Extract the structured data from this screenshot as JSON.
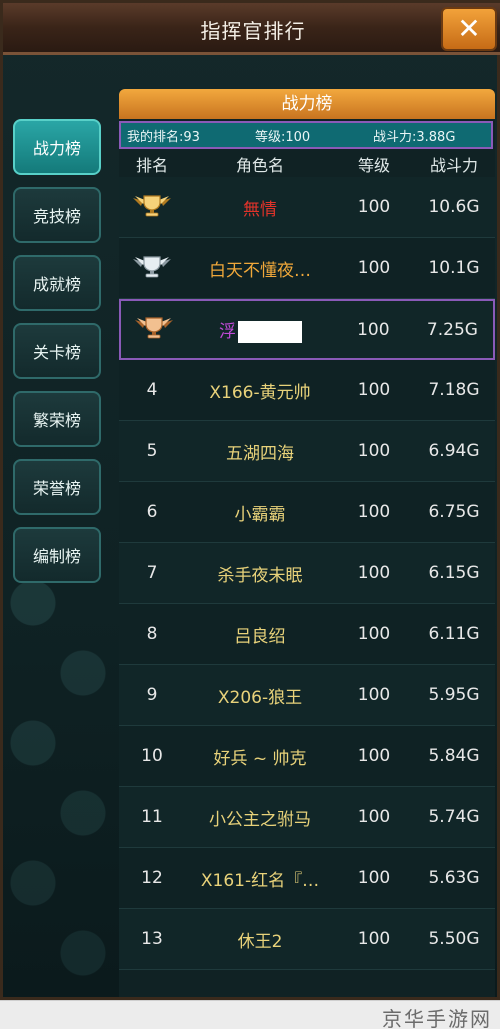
{
  "header": {
    "title": "指挥官排行",
    "close_icon": "close-icon"
  },
  "sidebar": {
    "items": [
      {
        "label": "战力榜",
        "active": true
      },
      {
        "label": "竞技榜",
        "active": false
      },
      {
        "label": "成就榜",
        "active": false
      },
      {
        "label": "关卡榜",
        "active": false
      },
      {
        "label": "繁荣榜",
        "active": false
      },
      {
        "label": "荣誉榜",
        "active": false
      },
      {
        "label": "编制榜",
        "active": false
      }
    ]
  },
  "panel": {
    "title": "战力榜",
    "my_rank": {
      "rank": "我的排名:93",
      "level": "等级:100",
      "power": "战斗力:3.88G"
    },
    "columns": [
      "排名",
      "角色名",
      "等级",
      "战斗力"
    ],
    "rows": [
      {
        "rank": "",
        "medal": "gold-trophy",
        "name": "無情",
        "name_color": "#e0332a",
        "level": "100",
        "power": "10.6G"
      },
      {
        "rank": "",
        "medal": "silver-trophy",
        "name": "白天不懂夜…",
        "name_color": "#f0a83a",
        "level": "100",
        "power": "10.1G"
      },
      {
        "rank": "",
        "medal": "bronze-trophy",
        "name": "浮",
        "name_color": "#c04ad8",
        "level": "100",
        "power": "7.25G",
        "mine": true
      },
      {
        "rank": "4",
        "name": "X166-黄元帅",
        "level": "100",
        "power": "7.18G"
      },
      {
        "rank": "5",
        "name": "五湖四海",
        "level": "100",
        "power": "6.94G"
      },
      {
        "rank": "6",
        "name": "小霸霸",
        "level": "100",
        "power": "6.75G"
      },
      {
        "rank": "7",
        "name": "杀手夜未眠",
        "level": "100",
        "power": "6.15G"
      },
      {
        "rank": "8",
        "name": "吕良绍",
        "level": "100",
        "power": "6.11G"
      },
      {
        "rank": "9",
        "name": "X206-狼王",
        "level": "100",
        "power": "5.95G"
      },
      {
        "rank": "10",
        "name": "好兵 ~ 帅克",
        "level": "100",
        "power": "5.84G"
      },
      {
        "rank": "11",
        "name": "小公主之驸马",
        "level": "100",
        "power": "5.74G"
      },
      {
        "rank": "12",
        "name": "X161-红名『…",
        "level": "100",
        "power": "5.63G"
      },
      {
        "rank": "13",
        "name": "休王2",
        "level": "100",
        "power": "5.50G"
      }
    ]
  },
  "watermark": "京华手游网",
  "colors": {
    "accent_orange": "#e8922c",
    "active_tab": "#1f8f8f",
    "highlight_border": "#8a5ab8",
    "name_default": "#e8d27a"
  }
}
